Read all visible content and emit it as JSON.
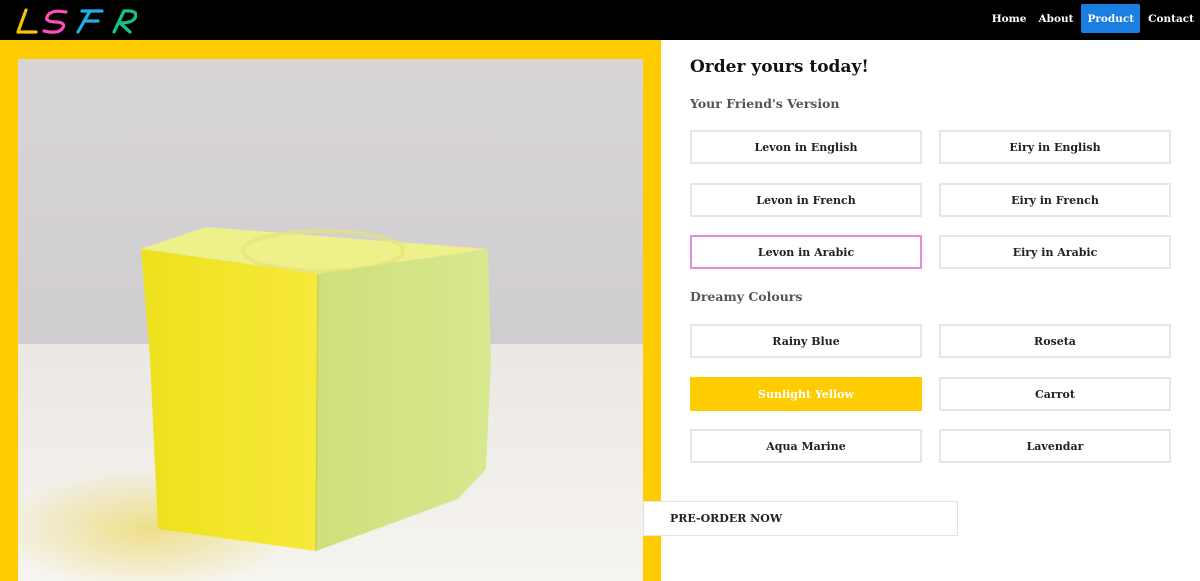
{
  "navbar": {
    "logo_text": "LSFR",
    "links": [
      "Home",
      "About",
      "Product",
      "Contact"
    ],
    "active_link": "Product"
  },
  "order": {
    "title": "Order yours today!",
    "version_heading": "Your Friend's Version",
    "versions": [
      "Levon in English",
      "Eiry in English",
      "Levon in French",
      "Eiry in French",
      "Levon in Arabic",
      "Eiry in Arabic"
    ],
    "focused_version": "Levon in Arabic",
    "colours_heading": "Dreamy Colours",
    "colours": [
      "Rainy Blue",
      "Roseta",
      "Sunlight Yellow",
      "Carrot",
      "Aqua Marine",
      "Lavendar"
    ],
    "selected_colour": "Sunlight Yellow",
    "preorder_label": "PRE-ORDER NOW"
  },
  "colors": {
    "accent_yellow": "#ffcc00",
    "nav_active": "#1a7fe0",
    "focus_border": "#e28de0"
  }
}
